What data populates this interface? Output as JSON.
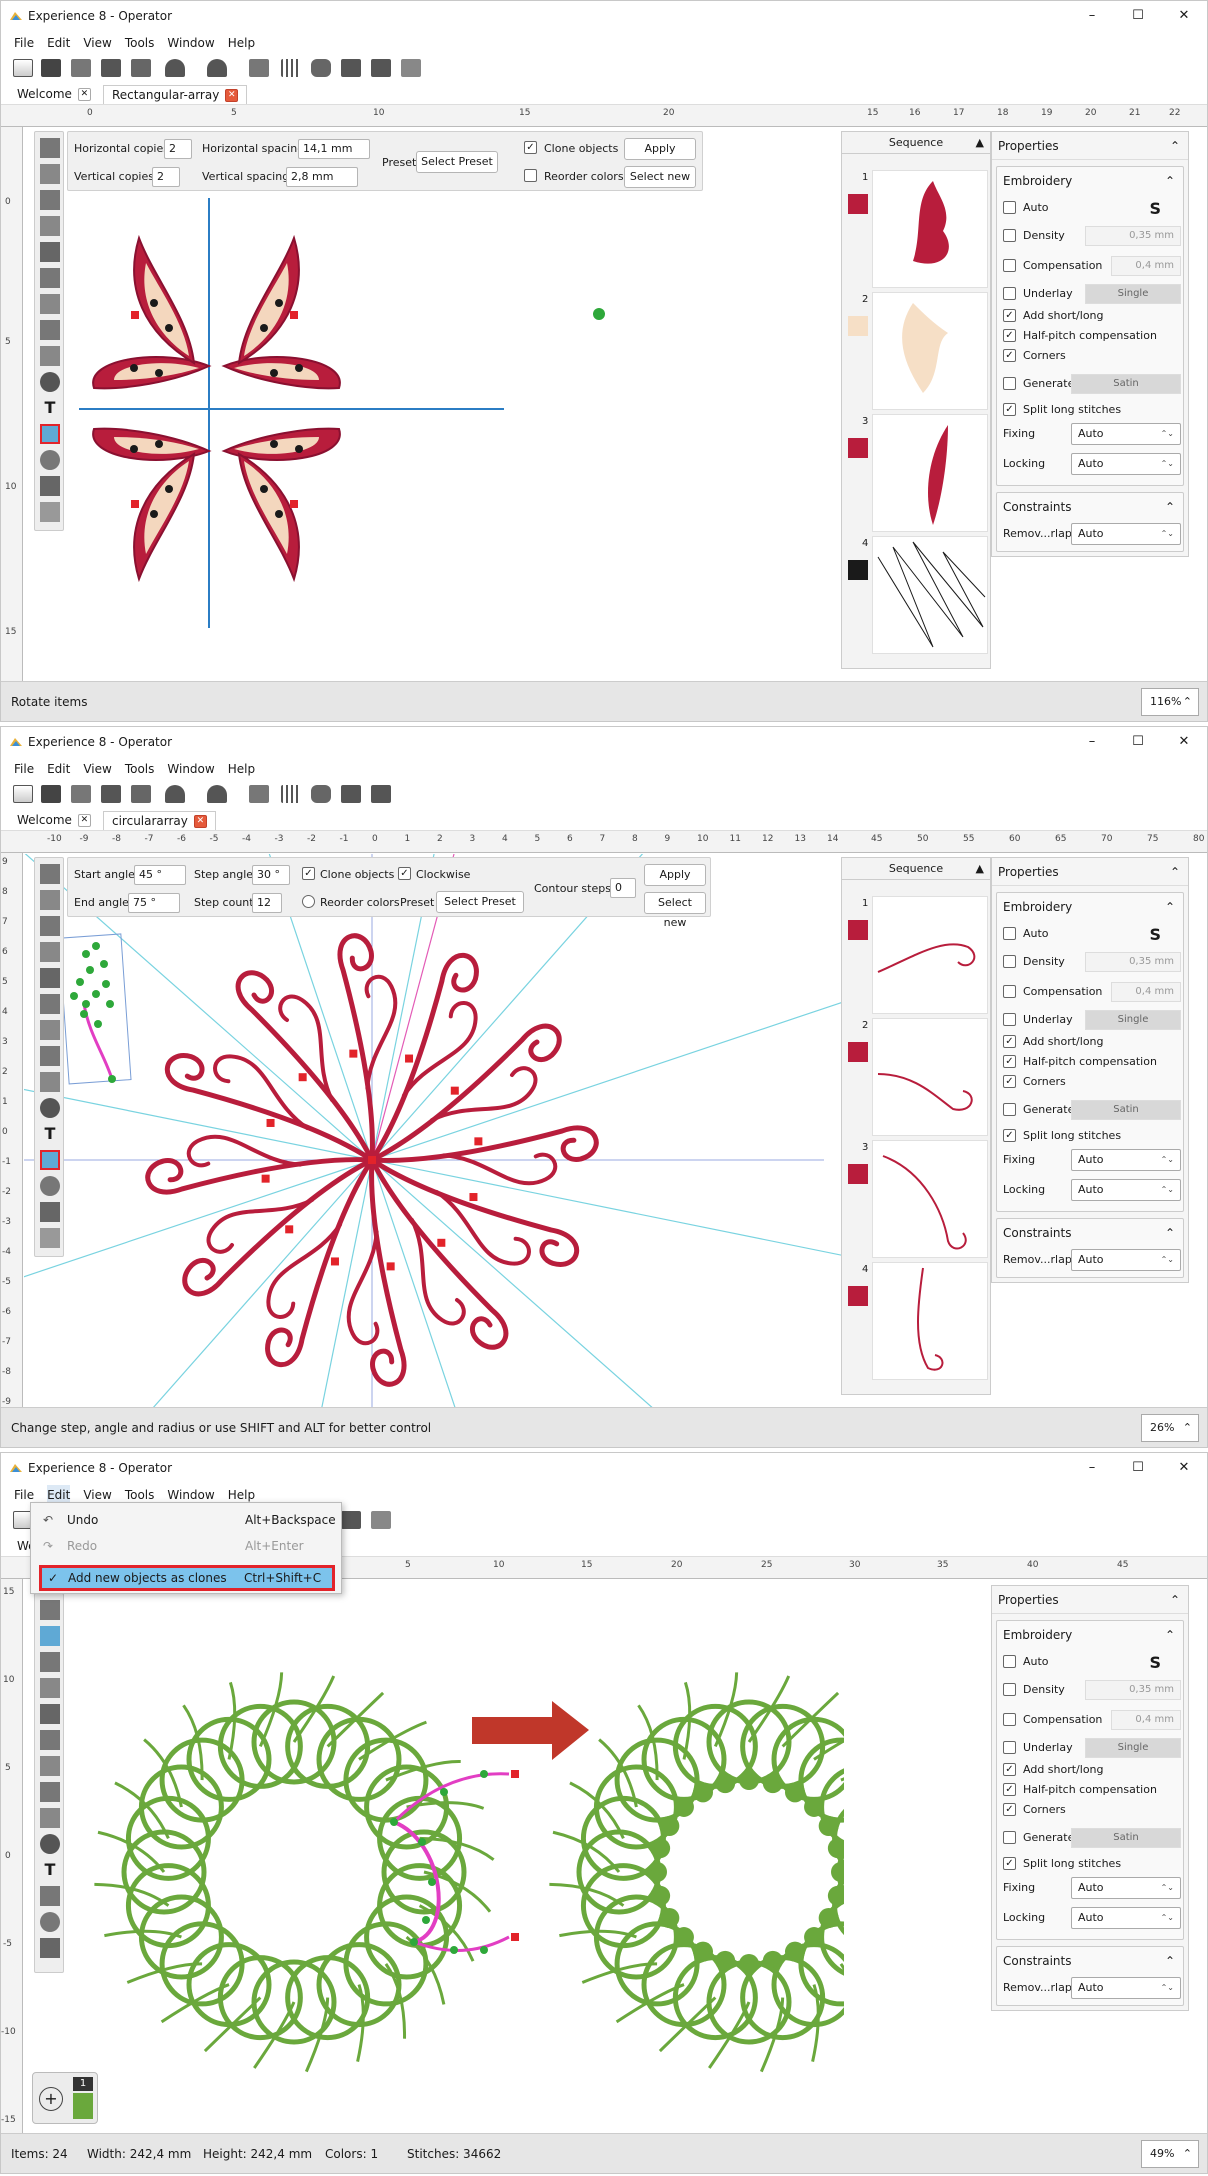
{
  "app_title": "Experience 8 - Operator",
  "menu": [
    "File",
    "Edit",
    "View",
    "Tools",
    "Window",
    "Help"
  ],
  "ruler_unit": "cm",
  "colors": {
    "accent_red": "#e2232a",
    "highlight_blue": "#7cc3ec",
    "embroidery_red": "#b81d3c",
    "embroidery_green": "#6aa83c",
    "magenta": "#e23ec3"
  },
  "window_controls": {
    "min": "–",
    "max": "☐",
    "close": "✕"
  },
  "icons": [
    "file-icon",
    "open-icon",
    "stitch-icon",
    "export-icon",
    "print-icon",
    "undo-icon",
    "redo-icon",
    "copy-icon",
    "grid-icon",
    "view-icon",
    "machine-icon",
    "send-icon",
    "help-cursor-icon"
  ],
  "panel1": {
    "tabs": [
      "Welcome",
      "Rectangular-array"
    ],
    "ruler_top": [
      "0",
      "5",
      "10",
      "15",
      "20",
      "15",
      "16",
      "17",
      "18",
      "19",
      "20",
      "21",
      "22"
    ],
    "ruler_side": [
      "0",
      "5",
      "10",
      "15"
    ],
    "options": {
      "h_copies_label": "Horizontal copies:",
      "h_copies": "2",
      "h_spacing_label": "Horizontal spacing:",
      "h_spacing": "14,1 mm",
      "v_copies_label": "Vertical copies:",
      "v_copies": "2",
      "v_spacing_label": "Vertical spacing:",
      "v_spacing": "2,8 mm",
      "preset_label": "Preset",
      "preset_value": "Select Preset",
      "clone_label": "Clone objects",
      "reorder_label": "Reorder colors",
      "apply": "Apply",
      "select_new": "Select new"
    },
    "status": "Rotate items",
    "zoom": "116%"
  },
  "panel2": {
    "tabs": [
      "Welcome",
      "circulararray"
    ],
    "ruler_top": [
      "-10",
      "-9",
      "-8",
      "-7",
      "-6",
      "-5",
      "-4",
      "-3",
      "-2",
      "-1",
      "0",
      "1",
      "2",
      "3",
      "4",
      "5",
      "6",
      "7",
      "8",
      "9",
      "10",
      "11",
      "12",
      "13",
      "14",
      "45",
      "50",
      "55",
      "60",
      "65",
      "70",
      "75",
      "80"
    ],
    "ruler_side": [
      "9",
      "8",
      "7",
      "6",
      "5",
      "4",
      "3",
      "2",
      "1",
      "0",
      "-1",
      "-2",
      "-3",
      "-4",
      "-5",
      "-6",
      "-7",
      "-8",
      "-9"
    ],
    "options": {
      "start_angle_label": "Start angle:",
      "start_angle": "45 °",
      "step_angle_label": "Step angle:",
      "step_angle": "30 °",
      "clone_label": "Clone objects",
      "clockwise_label": "Clockwise",
      "contour_steps_label": "Contour steps:",
      "contour_steps": "0",
      "apply": "Apply",
      "end_angle_label": "End angle:",
      "end_angle": "75 °",
      "step_count_label": "Step count:",
      "step_count": "12",
      "reorder_label": "Reorder colors",
      "preset_label": "Preset",
      "preset_value": "Select Preset",
      "select_new": "Select new"
    },
    "status": "Change step, angle and radius or use SHIFT and ALT for better control",
    "zoom": "26%"
  },
  "panel3": {
    "tab_partial": "Wel",
    "ruler_top": [
      "5",
      "10",
      "15",
      "20",
      "25",
      "30",
      "35",
      "40",
      "45"
    ],
    "ruler_side": [
      "15",
      "10",
      "5",
      "0",
      "-5",
      "-10",
      "-15"
    ],
    "edit_menu": [
      {
        "label": "Undo",
        "shortcut": "Alt+Backspace"
      },
      {
        "label": "Redo",
        "shortcut": "Alt+Enter"
      },
      {
        "label": "Add new objects as clones",
        "shortcut": "Ctrl+Shift+C",
        "check": "✓"
      }
    ],
    "badge_count": "1",
    "badge_add": "+",
    "status": {
      "items": "Items: 24",
      "width": "Width: 242,4 mm",
      "height": "Height: 242,4 mm",
      "colors": "Colors: 1",
      "stitches": "Stitches: 34662"
    },
    "zoom": "49%"
  },
  "sequence": {
    "title": "Sequence",
    "numbers": [
      "1",
      "2",
      "3",
      "4"
    ]
  },
  "panel1_swatches": [
    "#b81d3c",
    "#f6dfc6",
    "#b81d3c",
    "#1a1a1a"
  ],
  "panel2_swatches": [
    "#b81d3c",
    "#b81d3c",
    "#b81d3c",
    "#b81d3c"
  ],
  "properties": {
    "title": "Properties",
    "embroidery": "Embroidery",
    "auto": "Auto",
    "density": "Density",
    "density_val": "0,35 mm",
    "compensation": "Compensation",
    "compensation_val": "0,4 mm",
    "underlay": "Underlay",
    "underlay_val": "Single",
    "add_short_long": "Add short/long",
    "half_pitch": "Half-pitch compensation",
    "corners": "Corners",
    "generate_as": "Generate as:",
    "generate_val": "Satin",
    "split_long": "Split long stitches",
    "fixing": "Fixing",
    "fixing_val": "Auto",
    "locking": "Locking",
    "locking_val": "Auto",
    "constraints": "Constraints",
    "remov": "Remov...rlaps",
    "remov_val": "Auto"
  }
}
